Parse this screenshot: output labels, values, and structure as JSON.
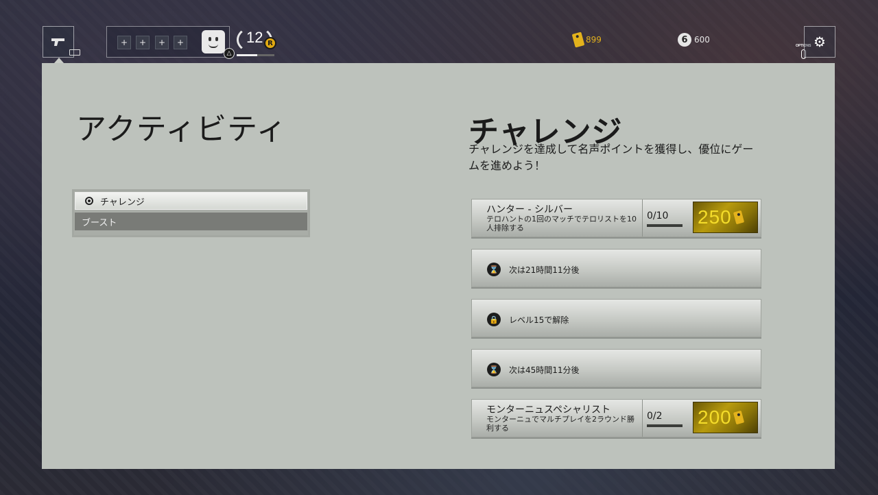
{
  "currencies": {
    "renown": "899",
    "credits": "600"
  },
  "level": {
    "number": "12",
    "coin_letter": "R",
    "progress": 0.55
  },
  "options": {
    "label": "OPTIONS",
    "icon": "gear-icon"
  },
  "activity": {
    "title": "アクティビティ",
    "menu": [
      {
        "label": "チャレンジ",
        "selected": true
      },
      {
        "label": "ブースト",
        "selected": false
      }
    ]
  },
  "challenges": {
    "title": "チャレンジ",
    "description": "チャレンジを達成して名声ポイントを獲得し、優位にゲームを進めよう！",
    "cards": [
      {
        "name": "ハンター - シルバー",
        "sub": "テロハントの1回のマッチでテロリストを10人排除する",
        "progress": "0/10",
        "progress_fraction": 0,
        "reward": "250"
      },
      {
        "locked_text": "次は21時間11分後",
        "icon": "hourglass-icon"
      },
      {
        "locked_text": "レベル15で解除",
        "icon": "lock-icon"
      },
      {
        "locked_text": "次は45時間11分後",
        "icon": "hourglass-icon"
      },
      {
        "name": "モンターニュスペシャリスト",
        "sub": "モンターニュでマルチプレイを2ラウンド勝利する",
        "progress": "0/2",
        "progress_fraction": 0,
        "reward": "200"
      }
    ]
  },
  "colors": {
    "panel": "#bdc2bc",
    "renown_gold": "#e3b21c",
    "reward_text": "#f4dc2a"
  }
}
